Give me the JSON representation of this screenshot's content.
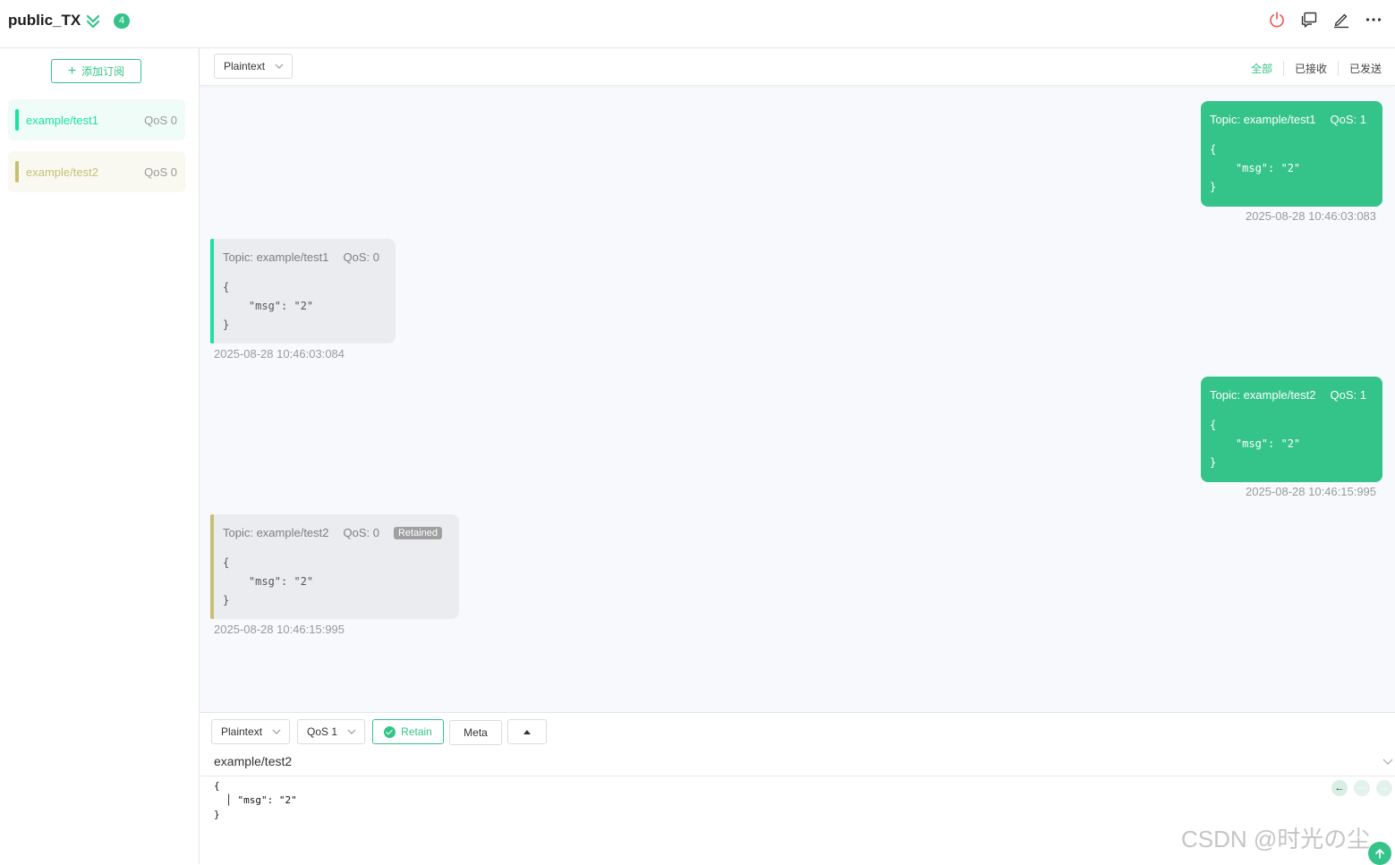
{
  "header": {
    "connection_name": "public_TX",
    "badge_count": "4",
    "icons": [
      "expand-icon",
      "power-icon",
      "messages-icon",
      "edit-icon",
      "more-icon"
    ]
  },
  "sidebar": {
    "add_subscription_label": "添加订阅",
    "subscriptions": [
      {
        "topic": "example/test1",
        "qos": "QoS 0",
        "color": "#19e3a0",
        "bg": "#effcf7"
      },
      {
        "topic": "example/test2",
        "qos": "QoS 0",
        "color": "#c6c076",
        "bg": "#faf9f1"
      }
    ]
  },
  "filterbar": {
    "payload_format": "Plaintext",
    "tabs": [
      "全部",
      "已接收",
      "已发送"
    ]
  },
  "messages": [
    {
      "direction": "sent",
      "topic": "Topic: example/test1",
      "qos": "QoS: 1",
      "payload": "{\n    \"msg\": \"2\"\n}",
      "time": "2025-08-28 10:46:03:083"
    },
    {
      "direction": "received",
      "topic": "Topic: example/test1",
      "qos": "QoS: 0",
      "payload": "{\n    \"msg\": \"2\"\n}",
      "time": "2025-08-28 10:46:03:084",
      "color": "#19e3a0"
    },
    {
      "direction": "sent",
      "topic": "Topic: example/test2",
      "qos": "QoS: 1",
      "payload": "{\n    \"msg\": \"2\"\n}",
      "time": "2025-08-28 10:46:15:995"
    },
    {
      "direction": "received",
      "topic": "Topic: example/test2",
      "qos": "QoS: 0",
      "retained": "Retained",
      "payload": "{\n    \"msg\": \"2\"\n}",
      "time": "2025-08-28 10:46:15:995",
      "color": "#c6c076"
    }
  ],
  "composer": {
    "format": "Plaintext",
    "qos": "QoS 1",
    "retain_label": "Retain",
    "meta_label": "Meta",
    "topic": "example/test2",
    "payload": "{\n  │ \"msg\": \"2\"\n}"
  },
  "watermark": "CSDN @时光の尘",
  "colors": {
    "accent": "#34c388",
    "danger": "#f0524f"
  }
}
